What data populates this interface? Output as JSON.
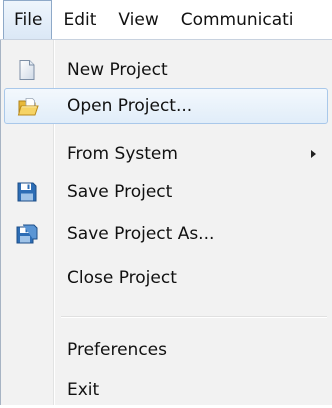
{
  "menubar": {
    "items": [
      {
        "label": "File"
      },
      {
        "label": "Edit"
      },
      {
        "label": "View"
      },
      {
        "label": "Communicati"
      }
    ]
  },
  "file_menu": {
    "items": [
      {
        "label": "New Project",
        "icon": "new-document-icon"
      },
      {
        "label": "Open Project...",
        "icon": "open-folder-icon",
        "highlighted": true
      },
      {
        "label": "From System",
        "has_submenu": true
      },
      {
        "label": "Save Project",
        "icon": "floppy-disk-icon"
      },
      {
        "label": "Save Project As...",
        "icon": "floppy-disk-as-icon"
      },
      {
        "label": "Close Project"
      },
      {
        "label": "Preferences"
      },
      {
        "label": "Exit"
      }
    ]
  },
  "colors": {
    "highlight_border": "#a9c8ea",
    "highlight_fill": "#e1edf9",
    "menu_background": "#f2f2f2",
    "save_icon_blue": "#2d6db5"
  }
}
